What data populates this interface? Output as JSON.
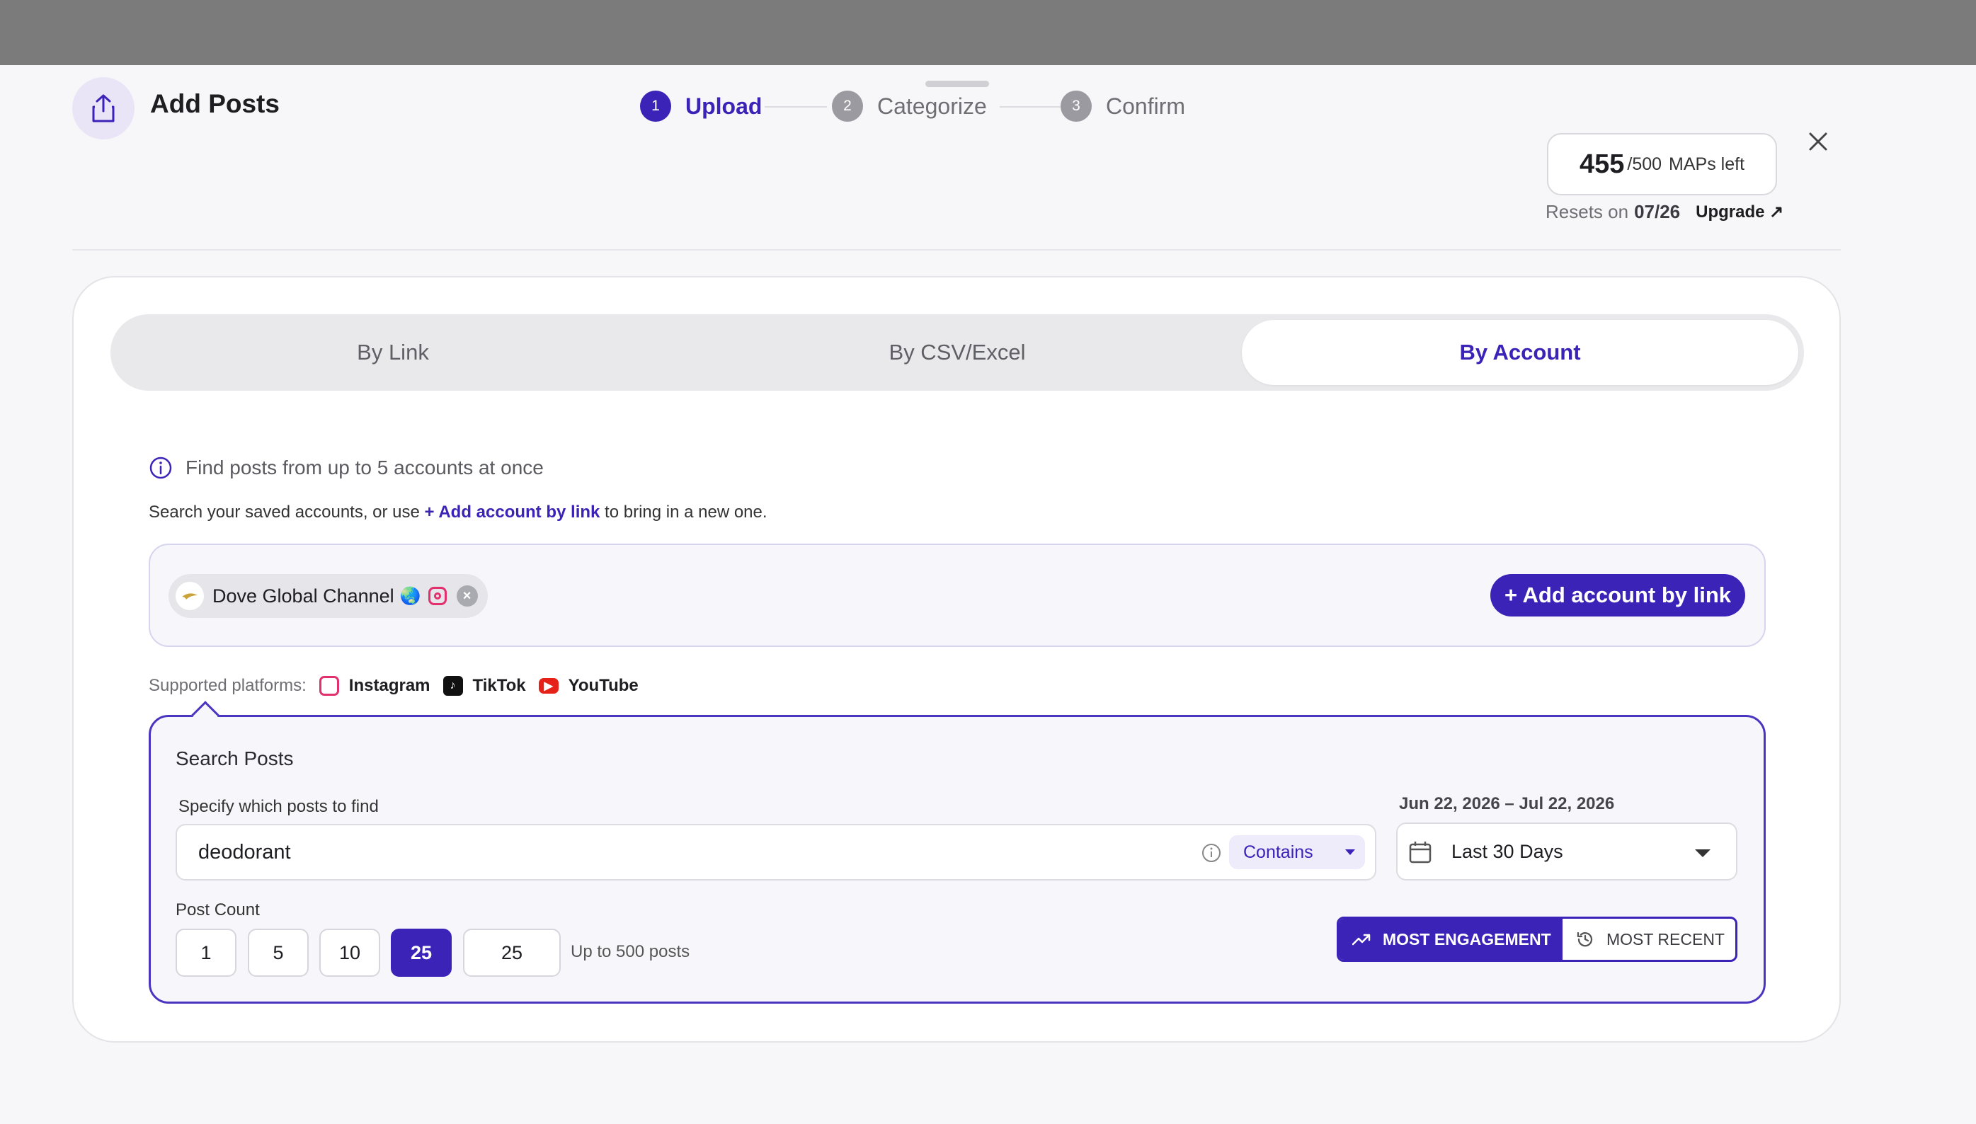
{
  "header": {
    "title": "Add Posts",
    "steps": [
      {
        "num": "1",
        "label": "Upload",
        "state": "active"
      },
      {
        "num": "2",
        "label": "Categorize",
        "state": "inactive"
      },
      {
        "num": "3",
        "label": "Confirm",
        "state": "inactive"
      }
    ],
    "maps": {
      "used": "455",
      "total": "/500",
      "suffix": "MAPs left"
    },
    "resets_label": "Resets on",
    "resets_date": "07/26",
    "upgrade_label": "Upgrade ↗"
  },
  "tabs": [
    {
      "label": "By Link",
      "selected": false
    },
    {
      "label": "By CSV/Excel",
      "selected": false
    },
    {
      "label": "By Account",
      "selected": true
    }
  ],
  "account": {
    "info": "Find posts from up to 5 accounts at once",
    "hint_prefix": "Search your saved accounts, or use",
    "hint_link": "+ Add account by link",
    "hint_suffix": "to bring in a new one.",
    "chip": {
      "name": "Dove Global Channel",
      "emoji": "🌏"
    },
    "add_button": "+ Add account by link",
    "supported_label": "Supported platforms:",
    "platforms": [
      "Instagram",
      "TikTok",
      "YouTube"
    ]
  },
  "search": {
    "title": "Search Posts",
    "spec_label": "Specify which posts to find",
    "query": "deodorant",
    "match_mode": "Contains",
    "date_range": "Jun 22, 2026 – Jul 22, 2026",
    "date_preset": "Last 30 Days",
    "post_count_label": "Post Count",
    "counts": [
      "1",
      "5",
      "10",
      "25"
    ],
    "selected_count": "25",
    "custom_count": "25",
    "up_to": "Up to 500 posts",
    "sort_options": [
      "MOST ENGAGEMENT",
      "MOST RECENT"
    ],
    "sort_selected": "MOST ENGAGEMENT"
  },
  "colors": {
    "accent": "#3b23b8",
    "instagram": "#e1306c",
    "youtube": "#e62117"
  }
}
